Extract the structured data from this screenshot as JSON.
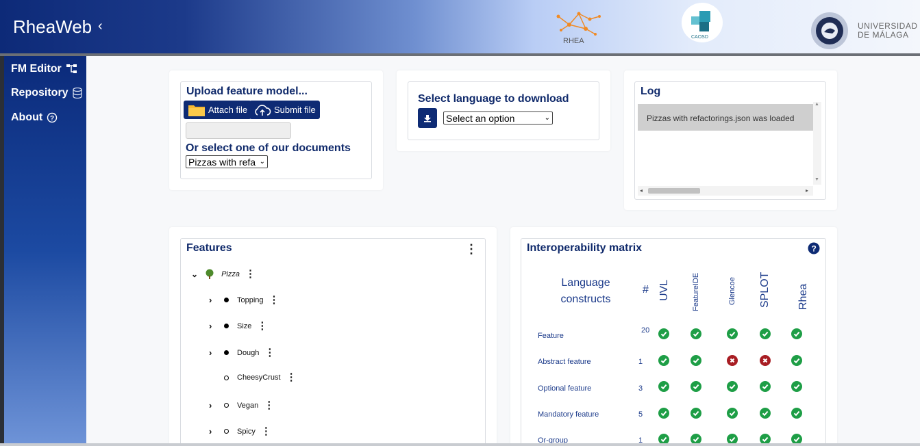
{
  "header": {
    "brand": "RheaWeb",
    "collapse_icon": "chevron-left-icon",
    "rhea_logo_text": "RHEA",
    "caosd_logo_text": "CAOSD",
    "uma_text_line1": "UNIVERSIDAD",
    "uma_text_line2": "DE MÁLAGA"
  },
  "sidebar": {
    "items": [
      {
        "label": "FM Editor",
        "icon": "hierarchy-icon"
      },
      {
        "label": "Repository",
        "icon": "database-icon"
      },
      {
        "label": "About",
        "icon": "help-circle-icon"
      }
    ]
  },
  "upload": {
    "title": "Upload feature model...",
    "attach_label": "Attach file",
    "submit_label": "Submit file",
    "or_select": "Or select one of our documents",
    "document_selected": "Pizzas with refa"
  },
  "download": {
    "title": "Select language to download",
    "select_value": "Select an option"
  },
  "log": {
    "title": "Log",
    "entry": "Pizzas with refactorings.json was loaded"
  },
  "features": {
    "title": "Features",
    "root": "Pizza",
    "children": [
      {
        "label": "Topping",
        "expandable": true,
        "mandatory": true
      },
      {
        "label": "Size",
        "expandable": true,
        "mandatory": true
      },
      {
        "label": "Dough",
        "expandable": true,
        "mandatory": true
      },
      {
        "label": "CheesyCrust",
        "expandable": false,
        "mandatory": false
      },
      {
        "label": "Vegan",
        "expandable": true,
        "mandatory": false
      },
      {
        "label": "Spicy",
        "expandable": true,
        "mandatory": false
      }
    ]
  },
  "matrix": {
    "title": "Interoperability matrix",
    "header_line1": "Language",
    "header_line2": "constructs",
    "count_header": "#",
    "languages": [
      "UVL",
      "FeatureIDE",
      "Glencoe",
      "SPLOT",
      "Rhea"
    ],
    "rows": [
      {
        "label": "Feature",
        "count": "20",
        "support": [
          true,
          true,
          true,
          true,
          true
        ]
      },
      {
        "label": "Abstract feature",
        "count": "1",
        "support": [
          true,
          true,
          false,
          false,
          true
        ]
      },
      {
        "label": "Optional feature",
        "count": "3",
        "support": [
          true,
          true,
          true,
          true,
          true
        ]
      },
      {
        "label": "Mandatory feature",
        "count": "5",
        "support": [
          true,
          true,
          true,
          true,
          true
        ]
      },
      {
        "label": "Or-group",
        "count": "1",
        "support": [
          true,
          true,
          true,
          true,
          true
        ]
      }
    ]
  }
}
